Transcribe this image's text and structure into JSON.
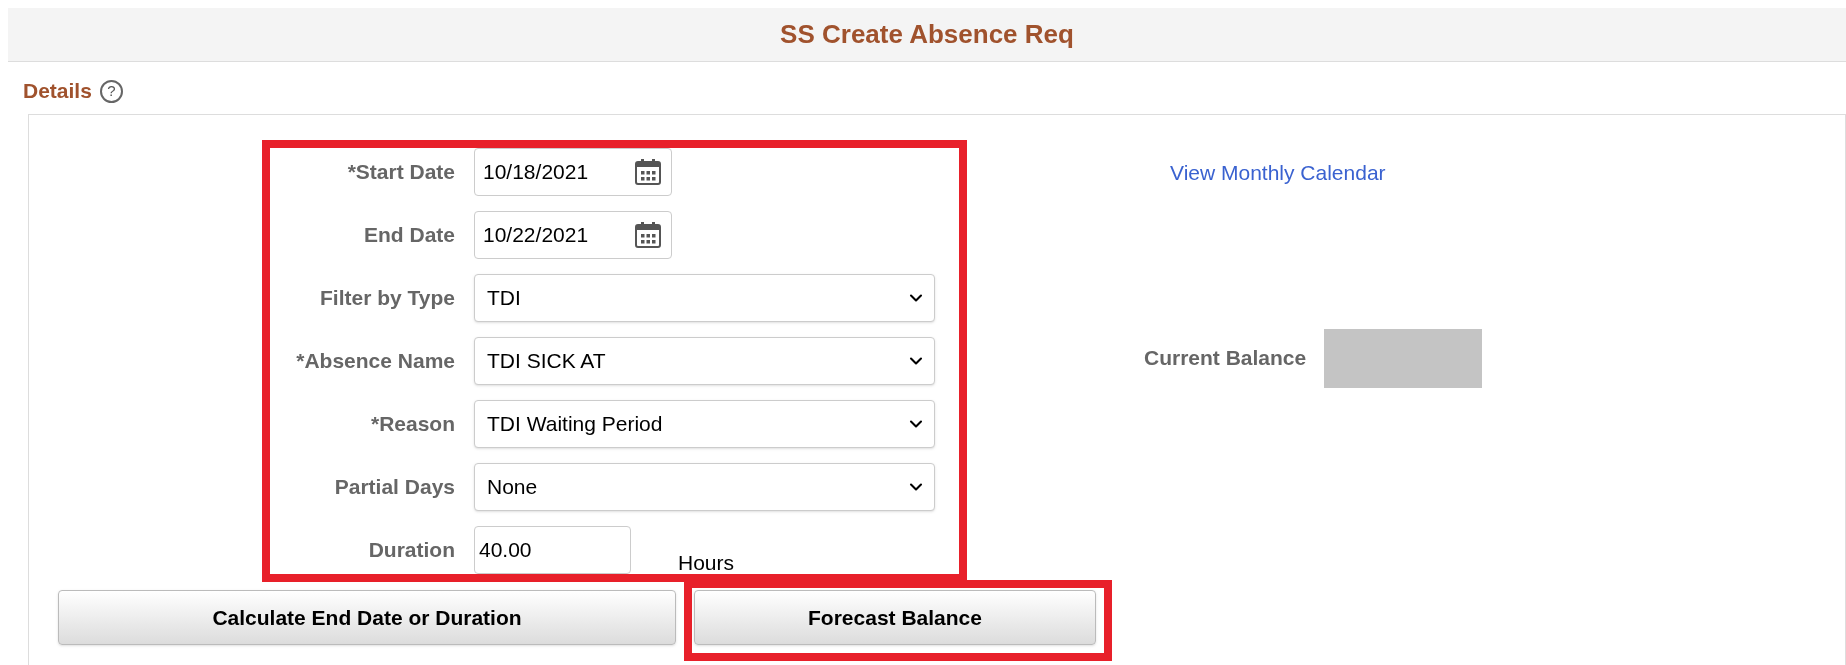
{
  "header": {
    "title": "SS Create Absence Req"
  },
  "section": {
    "title": "Details",
    "help": "?"
  },
  "form": {
    "highlighted": true,
    "fields": [
      {
        "kind": "date",
        "label": "*Start Date",
        "value": "10/18/2021"
      },
      {
        "kind": "date",
        "label": "End Date",
        "value": "10/22/2021"
      },
      {
        "kind": "select",
        "label": "Filter by Type",
        "value": "TDI"
      },
      {
        "kind": "select",
        "label": "*Absence Name",
        "value": "TDI SICK AT"
      },
      {
        "kind": "select",
        "label": "*Reason",
        "value": "TDI Waiting Period"
      },
      {
        "kind": "select",
        "label": "Partial Days",
        "value": "None"
      },
      {
        "kind": "number",
        "label": "Duration",
        "value": "40.00",
        "unit": "Hours"
      }
    ]
  },
  "link": "View Monthly Calendar",
  "balance": {
    "label": "Current Balance"
  },
  "buttons": [
    {
      "label": "Calculate End Date or Duration",
      "highlighted": false
    },
    {
      "label": "Forecast Balance",
      "highlighted": true
    }
  ]
}
